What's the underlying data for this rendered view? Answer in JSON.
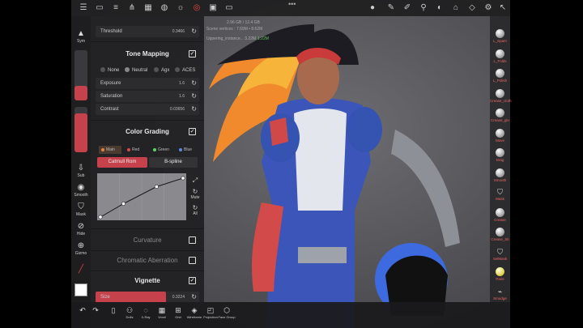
{
  "topbar": {
    "icons": [
      "menu-icon",
      "folder-icon",
      "sliders-icon",
      "tree-icon",
      "grid-icon",
      "sphere-icon",
      "sun-icon",
      "target-icon",
      "image-icon",
      "video-icon"
    ],
    "right_icons": [
      "material-icon",
      "brush-icon",
      "pen-icon",
      "pipette-icon",
      "gradient-icon",
      "bookmark-icon",
      "cube-icon",
      "settings-icon",
      "cursor-icon"
    ],
    "more": "•••"
  },
  "stats": {
    "vertices": "2.96 GB / 12.4 GB",
    "scene": "Scene vertices : 7.69M • 8.62M",
    "object": "Uppering_instance... 3.22M",
    "object_extra": "1.22M"
  },
  "left_tools": {
    "sym": "Sym",
    "sub": "Sub",
    "smooth": "Smooth",
    "mask": "Mask",
    "hide": "Hide",
    "gizmo": "Gizmo"
  },
  "panel": {
    "threshold": {
      "label": "Threshold",
      "value": "0.3466"
    },
    "tone_mapping": {
      "title": "Tone Mapping",
      "options": [
        "None",
        "Neutral",
        "Agx",
        "ACES"
      ],
      "selected": "Neutral",
      "exposure": {
        "label": "Exposure",
        "value": "1.6"
      },
      "saturation": {
        "label": "Saturation",
        "value": "1.6"
      },
      "contrast": {
        "label": "Contrast",
        "value": "0.03656"
      }
    },
    "color_grading": {
      "title": "Color Grading",
      "channels": [
        {
          "label": "Main",
          "color": "#e6813a"
        },
        {
          "label": "Red",
          "color": "#e04848"
        },
        {
          "label": "Green",
          "color": "#5ad65a"
        },
        {
          "label": "Blue",
          "color": "#5a8ae6"
        }
      ],
      "tabs": [
        "Catmull Rom",
        "B-spline"
      ],
      "active_tab": "Catmull Rom",
      "curve_tools": {
        "mute": "Mute",
        "all": "All"
      },
      "curve_points": [
        [
          0,
          0
        ],
        [
          0.28,
          0.33
        ],
        [
          0.68,
          0.75
        ],
        [
          1,
          0.96
        ]
      ]
    },
    "curvature": {
      "title": "Curvature"
    },
    "chromatic": {
      "title": "Chromatic Aberration"
    },
    "vignette": {
      "title": "Vignette",
      "size_label": "Size",
      "size_value": "0.3224"
    }
  },
  "bottombar": {
    "items": [
      "Dolls",
      "X-Ray",
      "Voxel",
      "Grid",
      "Wireframe",
      "Projection",
      "Face Group"
    ],
    "icons": [
      "undo-icon",
      "redo-icon",
      "doc-icon",
      "dolls-icon",
      "xray-icon",
      "voxel-icon",
      "grid-icon",
      "wireframe-icon",
      "projection-icon",
      "facegroup-icon"
    ]
  },
  "right_tools": [
    {
      "label": "L_Spam",
      "kind": "ball"
    },
    {
      "label": "L_Folds",
      "kind": "ball"
    },
    {
      "label": "L_Polish",
      "kind": "ball"
    },
    {
      "label": "Crease_cloth",
      "kind": "ball"
    },
    {
      "label": "Crease_glo",
      "kind": "ball"
    },
    {
      "label": "Move",
      "kind": "ball"
    },
    {
      "label": "Drag",
      "kind": "ball"
    },
    {
      "label": "Smooth",
      "kind": "ball"
    },
    {
      "label": "Mask",
      "kind": "sym"
    },
    {
      "label": "Crease",
      "kind": "ball"
    },
    {
      "label": "Crease_Sk",
      "kind": "ball"
    },
    {
      "label": "SelMask",
      "kind": "sym"
    },
    {
      "label": "Paint",
      "kind": "ball"
    },
    {
      "label": "Smudge",
      "kind": "sym"
    }
  ],
  "colors": {
    "accent": "#c5414c",
    "panel": "#222224",
    "viewport": "#5a5a5e"
  }
}
